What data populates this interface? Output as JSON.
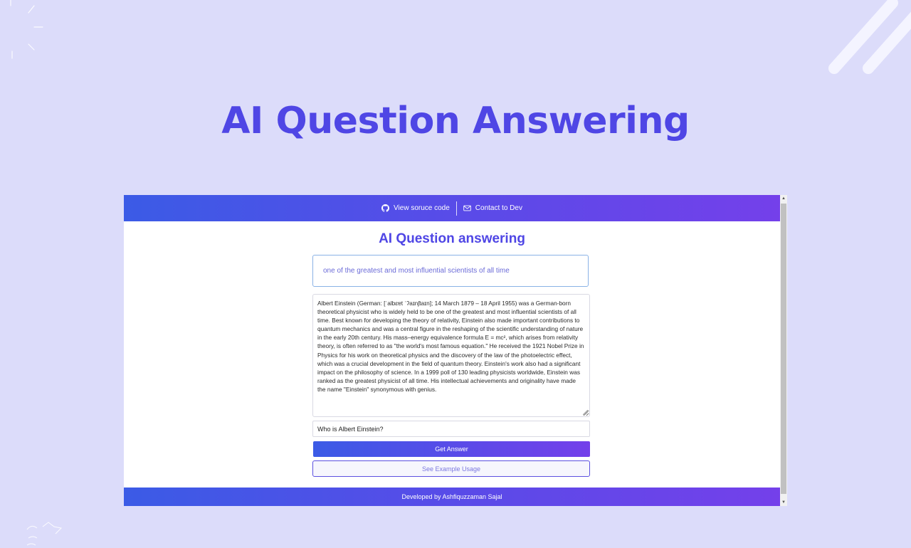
{
  "page": {
    "title": "AI Question Answering"
  },
  "app": {
    "topbar": {
      "source_link": "View soruce code",
      "contact_link": "Contact to Dev"
    },
    "heading": "AI Question answering",
    "context_input": {
      "value": "one of the greatest and most influential scientists of all time"
    },
    "passage": "Albert Einstein (German: [ˈalbɛɐt ˈʔaɪnʃtaɪn]; 14 March 1879 – 18 April 1955) was a German-born theoretical physicist who is widely held to be one of the greatest and most influential scientists of all time. Best known for developing the theory of relativity, Einstein also made important contributions to quantum mechanics and was a central figure in the reshaping of the scientific understanding of nature in the early 20th century. His mass–energy equivalence formula E = mc², which arises from relativity theory, is often referred to as \"the world's most famous equation.\" He received the 1921 Nobel Prize in Physics for his work on theoretical physics and the discovery of the law of the photoelectric effect, which was a crucial development in the field of quantum theory. Einstein's work also had a significant impact on the philosophy of science. In a 1999 poll of 130 leading physicists worldwide, Einstein was ranked as the greatest physicist of all time. His intellectual achievements and originality have made the name \"Einstein\" synonymous with genius.",
    "question_input": {
      "value": "Who is Albert Einstein?"
    },
    "buttons": {
      "get_answer": "Get Answer",
      "see_example": "See Example Usage"
    },
    "footer": "Developed by Ashfiquzzaman Sajal"
  },
  "colors": {
    "accent": "#4f46e5",
    "gradient_start": "#3b5be6",
    "gradient_end": "#7440ea",
    "background": "#dcdcfa"
  },
  "icons": {
    "source": "github-icon",
    "contact": "mail-icon"
  }
}
